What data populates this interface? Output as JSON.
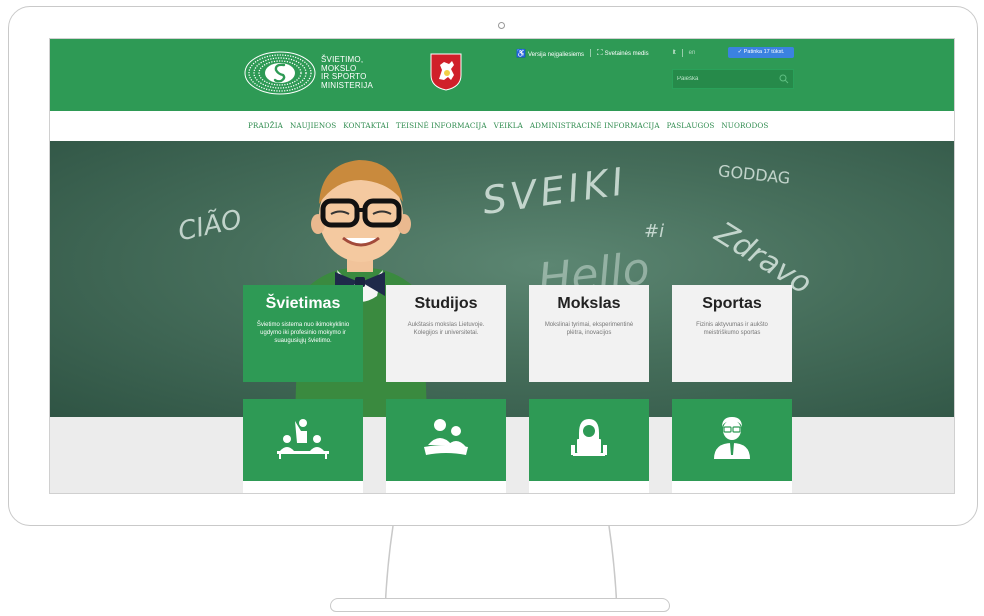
{
  "header": {
    "logo_lines": [
      "ŠVIETIMO,",
      "MOKSLO",
      "IR SPORTO",
      "MINISTERIJA"
    ],
    "top_links": {
      "accessibility": "Versija neįgaliesiems",
      "sitemap": "Svetainės medis",
      "lang_lt": "lt",
      "lang_en": "en"
    },
    "like_button": "Patinka 17 tūkst.",
    "search_placeholder": "Paieška"
  },
  "nav": {
    "items": [
      "PRADŽIA",
      "NAUJIENOS",
      "KONTAKTAI",
      "TEISINĖ INFORMACIJA",
      "VEIKLA",
      "ADMINISTRACINĖ INFORMACIJA",
      "PASLAUGOS",
      "NUORODOS"
    ]
  },
  "hero": {
    "chalk_words": [
      "CIÃO",
      "SVEIKI",
      "GODDAG",
      "Zdravo",
      "Hello",
      "#i"
    ]
  },
  "cards": [
    {
      "title": "Švietimas",
      "text": "Švietimo sistema nuo ikimokyklinio ugdymo iki profesinio mokymo ir suaugusiųjų švietimo."
    },
    {
      "title": "Studijos",
      "text": "Aukštasis mokslas Lietuvoje. Kolegijos ir universitetai."
    },
    {
      "title": "Mokslas",
      "text": "Mokslinai tyrimai, eksperimentinė plėtra, inovacijos"
    },
    {
      "title": "Sportas",
      "text": "Fizinis aktyvumas ir aukšto meistriškumo sportas"
    }
  ],
  "icons": [
    "classroom-icon",
    "students-reading-icon",
    "researcher-laptop-icon",
    "coach-icon"
  ],
  "colors": {
    "brand_green": "#2e9a55",
    "like_blue": "#3b82e0"
  }
}
